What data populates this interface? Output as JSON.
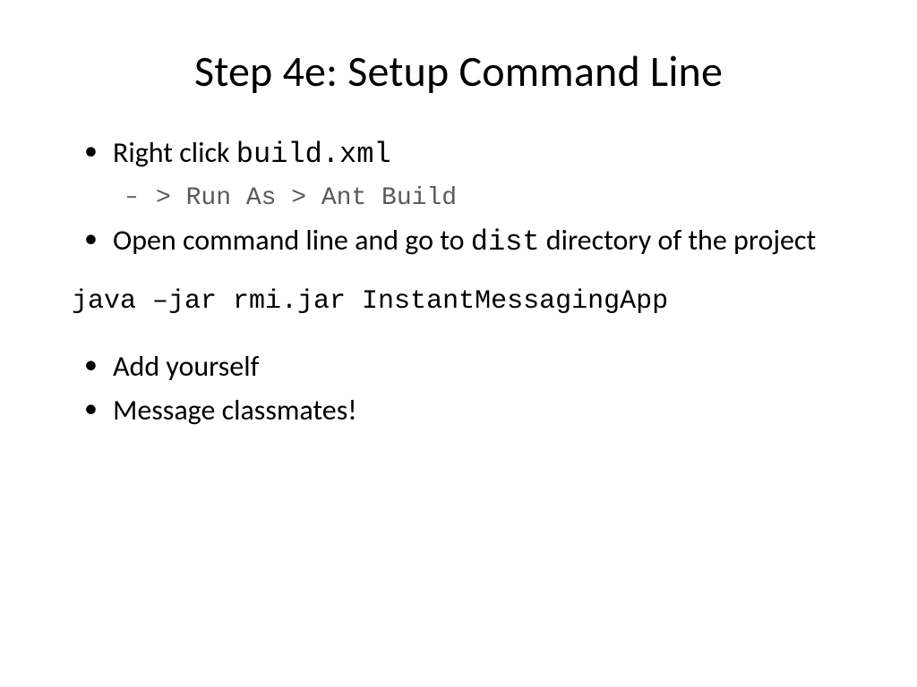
{
  "title": "Step 4e: Setup Command Line",
  "bullets": {
    "b1_prefix": "Right click ",
    "b1_code": "build.xml",
    "b1_sub_code": "> Run As > Ant Build",
    "b2_prefix": "Open command line and go to ",
    "b2_code": "dist",
    "b2_suffix": " directory of the project",
    "cmd": "java –jar rmi.jar InstantMessagingApp",
    "b3": "Add yourself",
    "b4": "Message classmates!"
  }
}
